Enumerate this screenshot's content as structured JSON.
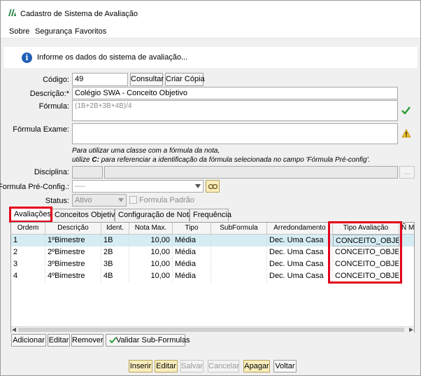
{
  "window": {
    "title": "Cadastro de Sistema de Avaliação"
  },
  "menu": [
    "Sobre",
    "Segurança",
    "Favoritos"
  ],
  "info": {
    "text": "Informe os dados do sistema de avaliação..."
  },
  "form": {
    "codigo": {
      "label": "Código:",
      "value": "49",
      "consultar": "Consultar",
      "criar_copia": "Criar Cópia"
    },
    "descricao": {
      "label": "Descrição:*",
      "value": "Colégio SWA - Conceito Objetivo"
    },
    "formula": {
      "label": "Fórmula:",
      "value": "(1B+2B+3B+4B)/4"
    },
    "formula_exame": {
      "label": "Fórmula Exame:",
      "value": ""
    },
    "hint_line1": "Para utilizar uma classe com a fórmula da nota,",
    "hint_line2_prefix": "utilize ",
    "hint_line2_bold": "C:",
    "hint_line2_suffix": " para referenciar a identificação da fórmula selecionada no campo 'Fórmula Pré-config'.",
    "disciplina": {
      "label": "Disciplina:",
      "button": "..."
    },
    "formula_preconfig": {
      "label": "Formula Pré-Config.:",
      "value": "----"
    },
    "status": {
      "label": "Status:",
      "value": "Ativo",
      "checkbox_label": "Formula Padrão"
    }
  },
  "tabs": [
    "Avaliações",
    "Conceitos Objetivos",
    "Configuração de Notas",
    "Frequência"
  ],
  "table": {
    "columns": [
      "Ordem",
      "Descrição",
      "Ident.",
      "Nota Max.",
      "Tipo",
      "SubFormula",
      "Arredondamento",
      "Tipo Avaliação",
      "Ñ Mo"
    ],
    "rows": [
      [
        "1",
        "1ºBimestre",
        "1B",
        "10,00",
        "Média",
        "",
        "Dec. Uma Casa",
        "CONCEITO_OBJETIVO",
        ""
      ],
      [
        "2",
        "2ºBimestre",
        "2B",
        "10,00",
        "Média",
        "",
        "Dec. Uma Casa",
        "CONCEITO_OBJETIVO",
        ""
      ],
      [
        "3",
        "3ºBimestre",
        "3B",
        "10,00",
        "Média",
        "",
        "Dec. Uma Casa",
        "CONCEITO_OBJETIVO",
        ""
      ],
      [
        "4",
        "4ºBimestre",
        "4B",
        "10,00",
        "Média",
        "",
        "Dec. Uma Casa",
        "CONCEITO_OBJETIVO",
        ""
      ]
    ]
  },
  "grid_buttons": [
    "Adicionar",
    "Editar",
    "Remover",
    "Validar Sub-Formulas"
  ],
  "footer_buttons": [
    "Inserir",
    "Editar",
    "Salvar",
    "Cancelar",
    "Apagar",
    "Voltar"
  ],
  "colors": {
    "highlight": "#e3001b",
    "selected_row": "#d5ecf3",
    "button_yellow": "#fbeebd",
    "info_blue": "#1f5fb8"
  }
}
